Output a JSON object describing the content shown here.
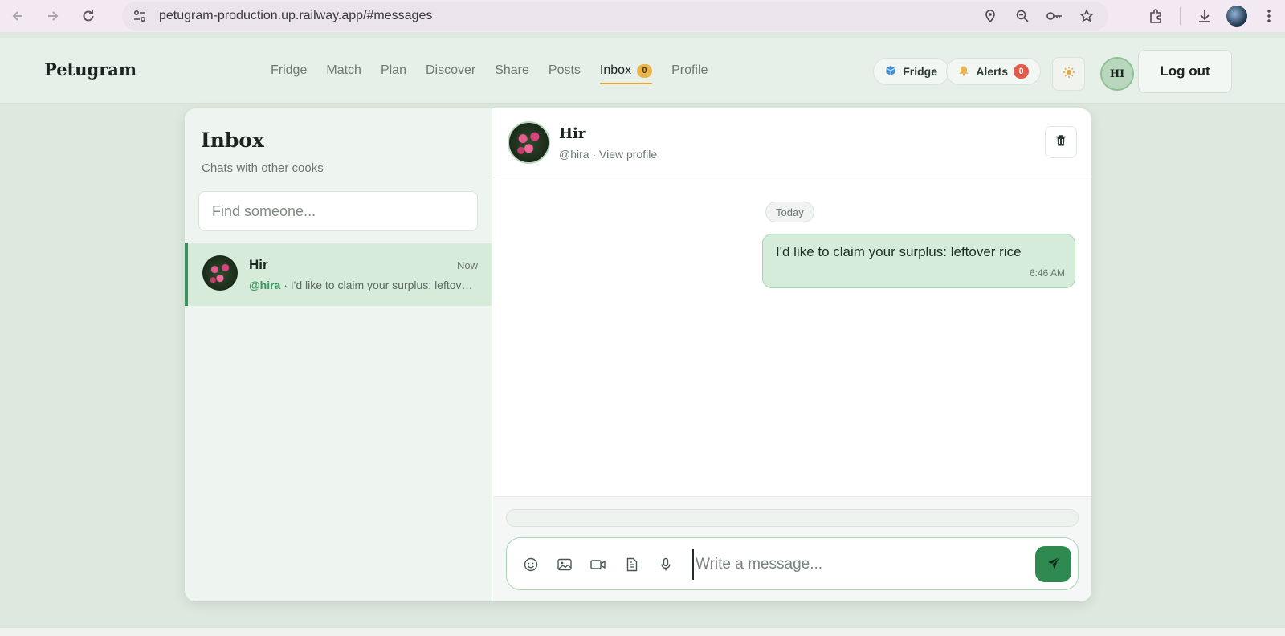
{
  "browser": {
    "url": "petugram-production.up.railway.app/#messages"
  },
  "header": {
    "brand": "Petugram",
    "nav": [
      {
        "label": "Fridge"
      },
      {
        "label": "Match"
      },
      {
        "label": "Plan"
      },
      {
        "label": "Discover"
      },
      {
        "label": "Share"
      },
      {
        "label": "Posts"
      },
      {
        "label": "Inbox",
        "badge": "0",
        "active": true
      },
      {
        "label": "Profile"
      }
    ],
    "fridge_pill": "Fridge",
    "alerts_pill": "Alerts",
    "alerts_count": "0",
    "theme_icon": "sun-icon",
    "avatar_initials": "HI",
    "logout_label": "Log out"
  },
  "inbox": {
    "title": "Inbox",
    "subtitle": "Chats with other cooks",
    "search_placeholder": "Find someone...",
    "conversations": [
      {
        "name": "Hir",
        "time": "Now",
        "handle": "@hira",
        "preview": " · I'd like to claim your surplus: leftover rice"
      }
    ]
  },
  "chat": {
    "name": "Hir",
    "handle": "@hira",
    "separator": " · ",
    "view_profile": "View profile",
    "day_label": "Today",
    "messages": [
      {
        "text": "I'd like to claim your surplus: leftover rice",
        "time": "6:46 AM",
        "outgoing": true
      }
    ],
    "composer_placeholder": "Write a message...",
    "tools": [
      "emoji-icon",
      "image-icon",
      "video-icon",
      "document-icon",
      "microphone-icon"
    ]
  },
  "colors": {
    "accent_green": "#2f8a52",
    "badge_yellow": "#e8b54a",
    "badge_red": "#e15b4c",
    "bubble_bg": "#d5ecda"
  }
}
